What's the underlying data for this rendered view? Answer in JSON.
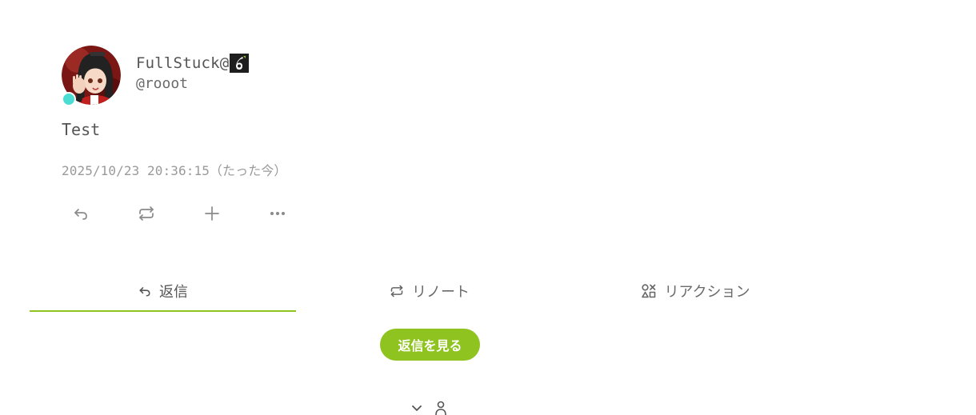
{
  "note": {
    "author": {
      "display_name": "FullStuck@",
      "username": "@rooot",
      "online": true,
      "online_color": "#4bdcd3"
    },
    "text": "Test",
    "timestamp": "2025/10/23 20:36:15（たった今）"
  },
  "actions": [
    {
      "icon": "reply-icon"
    },
    {
      "icon": "renote-icon"
    },
    {
      "icon": "plus-icon"
    },
    {
      "icon": "more-icon"
    }
  ],
  "tabs": [
    {
      "label": "返信",
      "icon": "reply-icon",
      "active": true
    },
    {
      "label": "リノート",
      "icon": "renote-icon",
      "active": false
    },
    {
      "label": "リアクション",
      "icon": "reaction-icon",
      "active": false
    }
  ],
  "show_replies_label": "返信を見る",
  "colors": {
    "accent": "#8fc31f",
    "text": "#555555",
    "muted": "#9a9a9a"
  },
  "footer": [
    {
      "icon": "chevron-down-icon"
    },
    {
      "icon": "user-icon"
    }
  ]
}
